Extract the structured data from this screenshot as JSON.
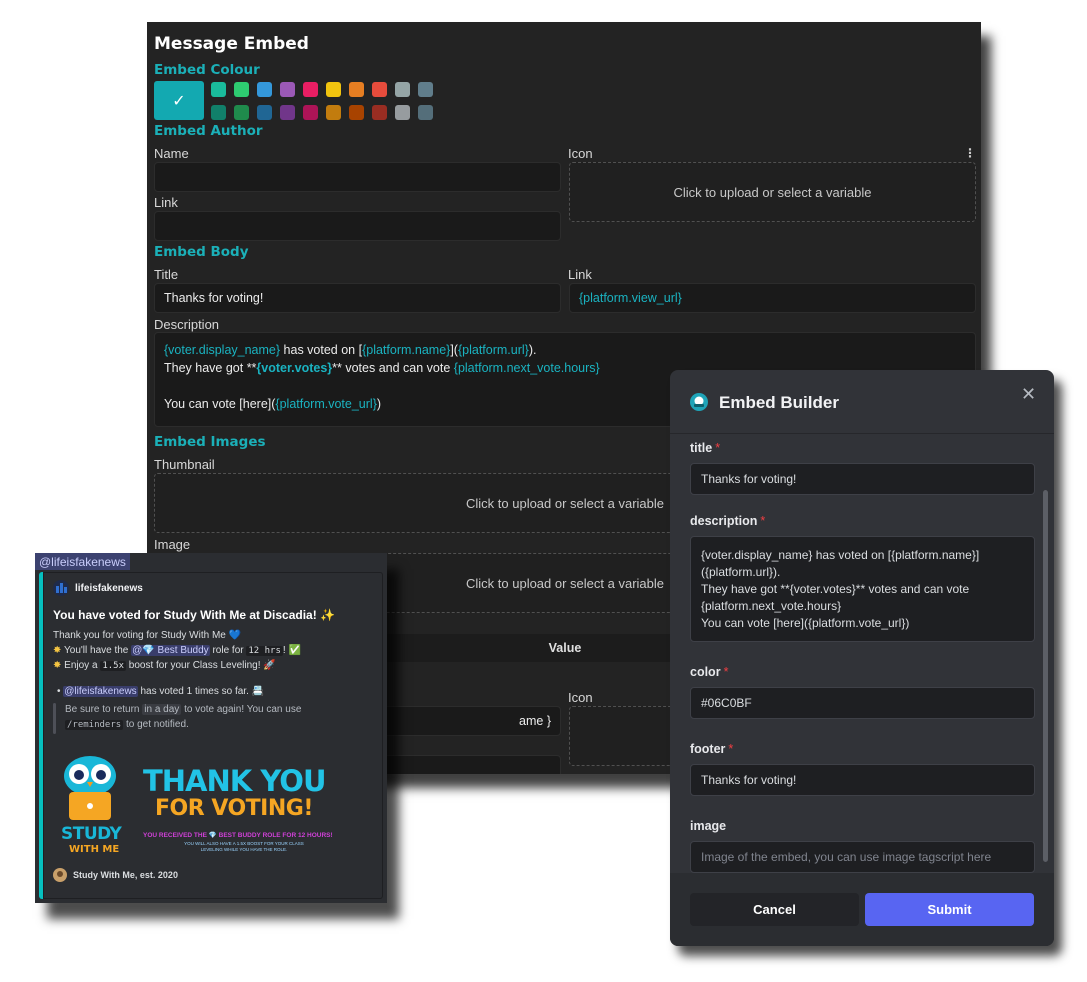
{
  "editor": {
    "title": "Message Embed",
    "colour_section": "Embed Colour",
    "checkmark_glyph": "✓",
    "swatches_top": [
      "#1abc9c",
      "#2ecc71",
      "#3498db",
      "#9b59b6",
      "#e91e63",
      "#f1c40f",
      "#e67e22",
      "#e74c3c",
      "#95a5a6",
      "#607d8b"
    ],
    "swatches_bottom": [
      "#11806a",
      "#1f8b4c",
      "#206694",
      "#71368a",
      "#ad1457",
      "#c27c0e",
      "#a84300",
      "#992d22",
      "#979c9f",
      "#546e7a"
    ],
    "selected_colour": "#13a9b1",
    "author_section": "Embed Author",
    "name_label": "Name",
    "icon_label": "Icon",
    "link_label": "Link",
    "upload_text": "Click to upload or select a variable",
    "body_section": "Embed Body",
    "title_label": "Title",
    "title_value": "Thanks for voting!",
    "body_link_label": "Link",
    "body_link_value": "{platform.view_url}",
    "description_label": "Description",
    "desc": {
      "l1_a": "{voter.display_name}",
      "l1_b": " has voted on [",
      "l1_c": "{platform.name}",
      "l1_d": "](",
      "l1_e": "{platform.url}",
      "l1_f": ").",
      "l2_a": "They have got **",
      "l2_b": "{voter.votes}",
      "l2_c": "** votes and can vote ",
      "l2_d": "{platform.next_vote.hours}",
      "l3_a": "You can vote [here](",
      "l3_b": "{platform.vote_url}",
      "l3_c": ")"
    },
    "images_section": "Embed Images",
    "thumbnail_label": "Thumbnail",
    "image_label": "Image",
    "value_header": "Value",
    "footer_icon_label": "Icon",
    "partial_value": "ame }"
  },
  "preview": {
    "tag": "@lifeisfakenews",
    "author": "lifeisfakenews",
    "title": "You have voted for Study With Me at Discadia! ✨",
    "thanks": "Thank you for voting for Study With Me 💙",
    "line1_a": "You'll have the ",
    "line1_role": "@💎 Best Buddy",
    "line1_b": " role for ",
    "line1_code": "12 hrs",
    "line1_c": "! ✅",
    "line2_a": "Enjoy a ",
    "line2_code": "1.5x",
    "line2_b": " boost for your Class Leveling! 🚀",
    "bullet_mention": "@lifeisfakenews",
    "bullet_text": " has voted 1 times so far. 📇",
    "quote_a": "Be sure to return ",
    "quote_dim": "in a day",
    "quote_b": " to vote again! You can use",
    "quote_code": "/reminders",
    "quote_c": " to get notified.",
    "banner_big1": "THANK YOU",
    "banner_big2": "FOR VOTING!",
    "banner_small": "YOU RECEIVED THE 💎 BEST BUDDY ROLE FOR 12 HOURS!",
    "banner_tiny": "YOU WILL ALSO HAVE A 1.5X BOOST FOR YOUR CLASS LEVELING WHILE YOU HAVE THE ROLE.",
    "study": "STUDY",
    "with_me": "WITH ME",
    "footer": "Study With Me, est. 2020"
  },
  "modal": {
    "title": "Embed Builder",
    "close_glyph": "✕",
    "title_label": "title",
    "title_value": "Thanks for voting!",
    "description_label": "description",
    "description_value": "{voter.display_name} has voted on [{platform.name}]\n({platform.url}).\nThey have got **{voter.votes}** votes and can vote\n{platform.next_vote.hours}\nYou can vote [here]({platform.vote_url})",
    "color_label": "color",
    "color_value": "#06C0BF",
    "footer_label": "footer",
    "footer_value": "Thanks for voting!",
    "image_label": "image",
    "image_placeholder": "Image of the embed, you can use image tagscript here",
    "required_mark": "*",
    "cancel": "Cancel",
    "submit": "Submit"
  }
}
